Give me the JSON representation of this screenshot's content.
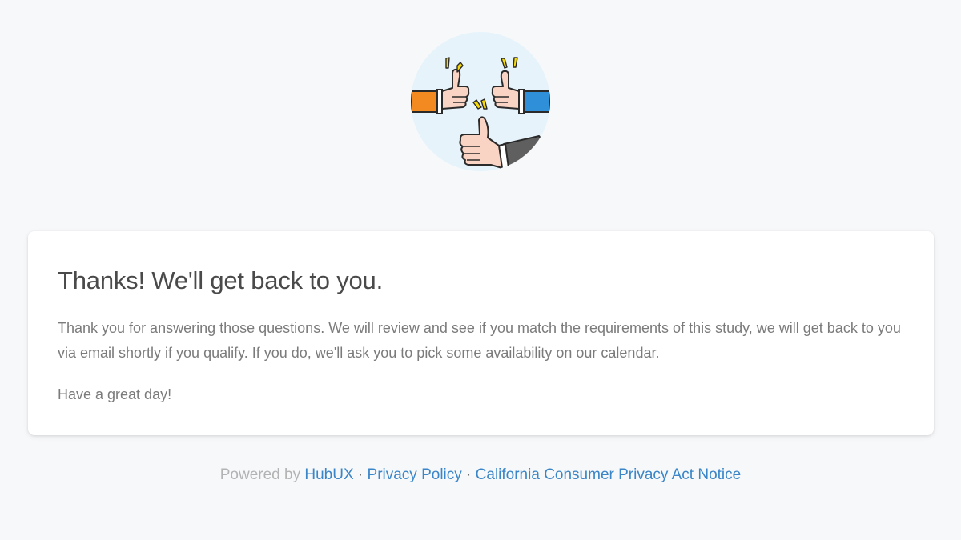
{
  "illustration": {
    "icon": "thumbs-up-hands-icon",
    "background": "#e6f3fb"
  },
  "card": {
    "title": "Thanks! We'll get back to you.",
    "body": "Thank you for answering those questions. We will review and see if you match the requirements of this study, we will get back to you via email shortly if you qualify. If you do, we'll ask you to pick some availability on our calendar.",
    "sign_off": "Have a great day!"
  },
  "footer": {
    "powered_by": "Powered by",
    "brand_link": "HubUX",
    "separator": "·",
    "privacy_link": "Privacy Policy",
    "ccpa_link": "California Consumer Privacy Act Notice"
  },
  "colors": {
    "page_background": "#f7f8fa",
    "link": "#3a86c8",
    "heading": "#4a4a4a",
    "body_text": "#7b7b7b"
  }
}
